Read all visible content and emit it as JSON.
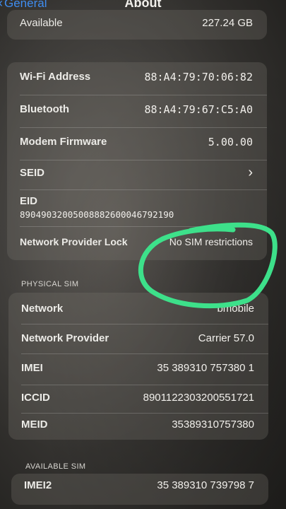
{
  "nav": {
    "back_label": "General",
    "title": "About"
  },
  "top_row": {
    "label": "Available",
    "value": "227.24 GB"
  },
  "info": {
    "wifi": {
      "label": "Wi-Fi Address",
      "value": "88:A4:79:70:06:82"
    },
    "bluetooth": {
      "label": "Bluetooth",
      "value": "88:A4:79:67:C5:A0"
    },
    "modem": {
      "label": "Modem Firmware",
      "value": "5.00.00"
    },
    "seid": {
      "label": "SEID",
      "chevron": "›"
    },
    "eid": {
      "label": "EID",
      "value": "89049032005008882600046792190"
    },
    "lock": {
      "label": "Network Provider Lock",
      "value": "No SIM restrictions"
    }
  },
  "physical_sim": {
    "header": "PHYSICAL SIM",
    "network": {
      "label": "Network",
      "value": "bmobile"
    },
    "provider": {
      "label": "Network Provider",
      "value": "Carrier 57.0"
    },
    "imei": {
      "label": "IMEI",
      "value": "35 389310 757380 1"
    },
    "iccid": {
      "label": "ICCID",
      "value": "8901122303200551721"
    },
    "meid": {
      "label": "MEID",
      "value": "35389310757380"
    }
  },
  "available_sim": {
    "header": "AVAILABLE SIM",
    "imei2": {
      "label": "IMEI2",
      "value": "35 389310 739798 7"
    }
  },
  "colors": {
    "accent_blue": "#3f8df0",
    "annotation_green": "#3de08a"
  }
}
